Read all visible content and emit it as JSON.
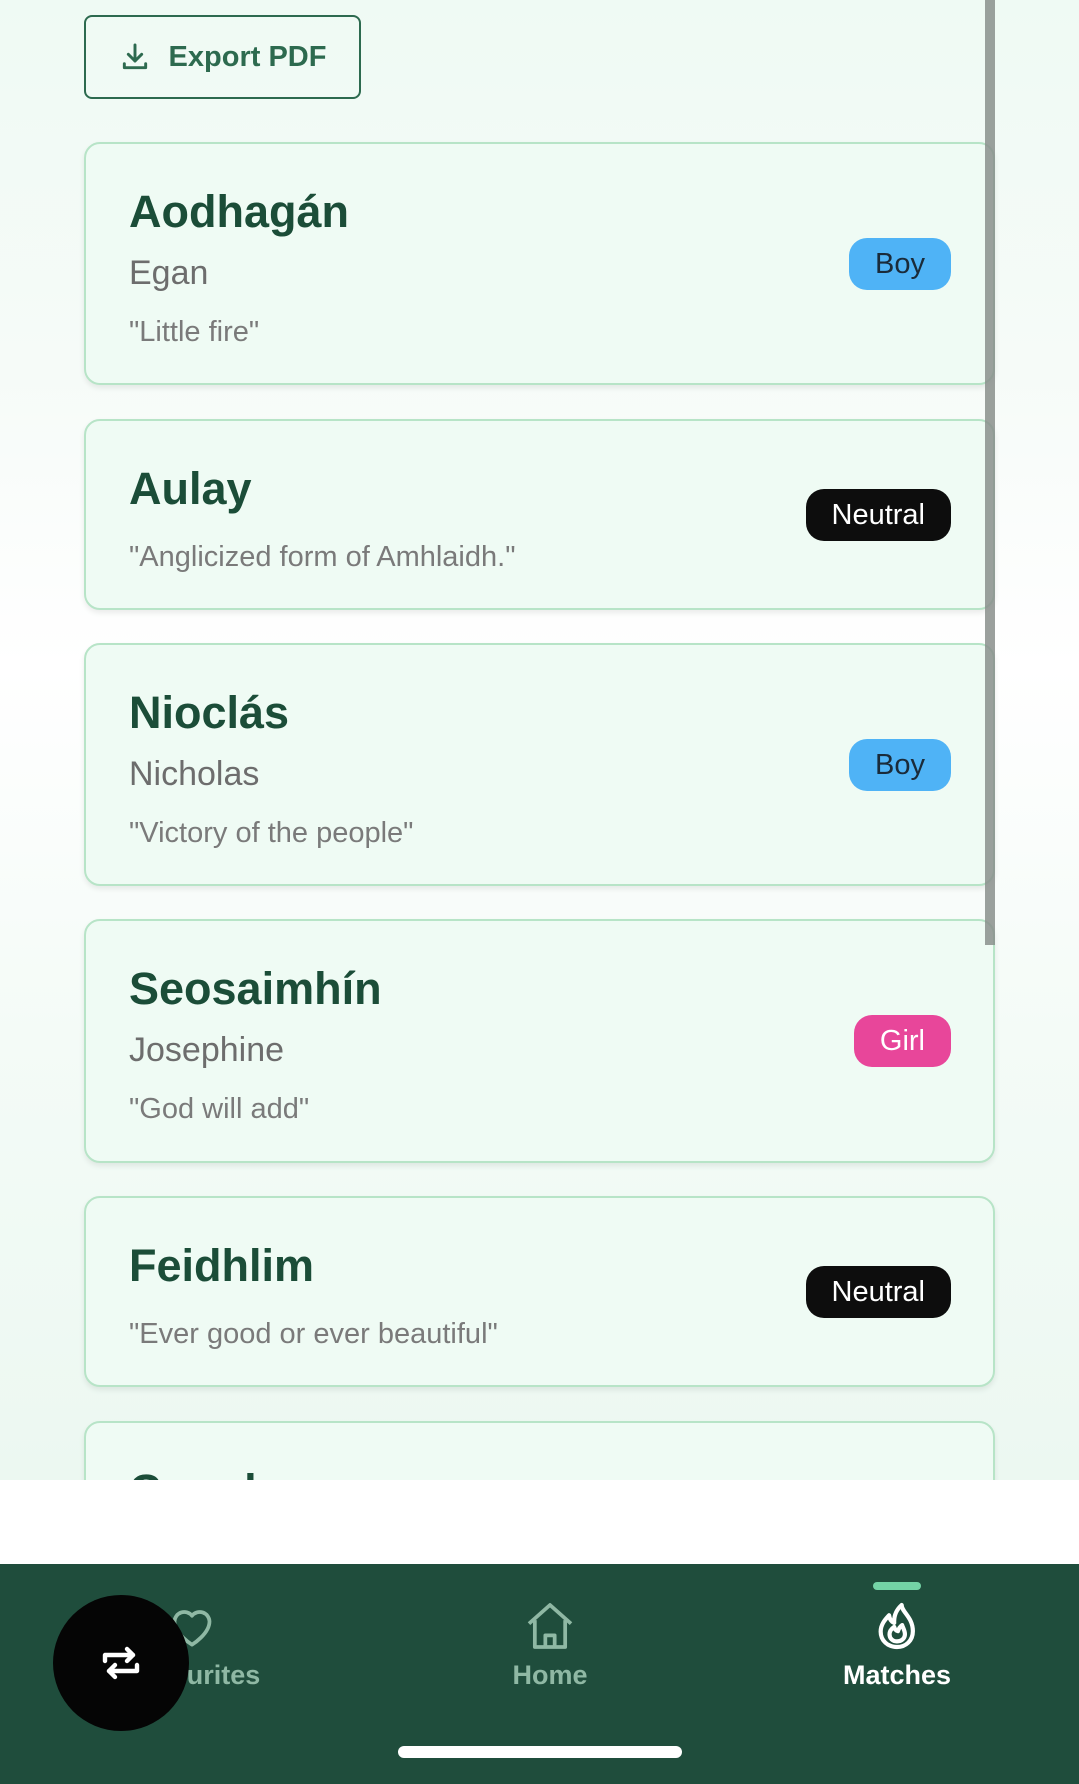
{
  "toolbar": {
    "export_label": "Export PDF"
  },
  "cards": [
    {
      "name": "Aodhagán",
      "english": "Egan",
      "meaning": "\"Little fire\"",
      "gender": "Boy"
    },
    {
      "name": "Aulay",
      "english": "",
      "meaning": "\"Anglicized form of Amhlaidh.\"",
      "gender": "Neutral"
    },
    {
      "name": "Nioclás",
      "english": "Nicholas",
      "meaning": "\"Victory of the people\"",
      "gender": "Boy"
    },
    {
      "name": "Seosaimhín",
      "english": "Josephine",
      "meaning": "\"God will add\"",
      "gender": "Girl"
    },
    {
      "name": "Feidhlim",
      "english": "",
      "meaning": "\"Ever good or ever beautiful\"",
      "gender": "Neutral"
    },
    {
      "name": "Caradoc",
      "english": "",
      "meaning": "",
      "gender": ""
    }
  ],
  "nav": {
    "favourites": "Favourites",
    "home": "Home",
    "matches": "Matches",
    "active": "Matches"
  },
  "colors": {
    "accent": "#2d6a4f",
    "nav_bg": "#1f4d3c",
    "boy": "#4fb3f6",
    "girl": "#e8469a",
    "neutral": "#0d0d0d"
  },
  "icons": {
    "export": "download-icon",
    "favourites": "heart-icon",
    "home": "home-icon",
    "matches": "flame-icon",
    "fab": "repeat-icon"
  }
}
